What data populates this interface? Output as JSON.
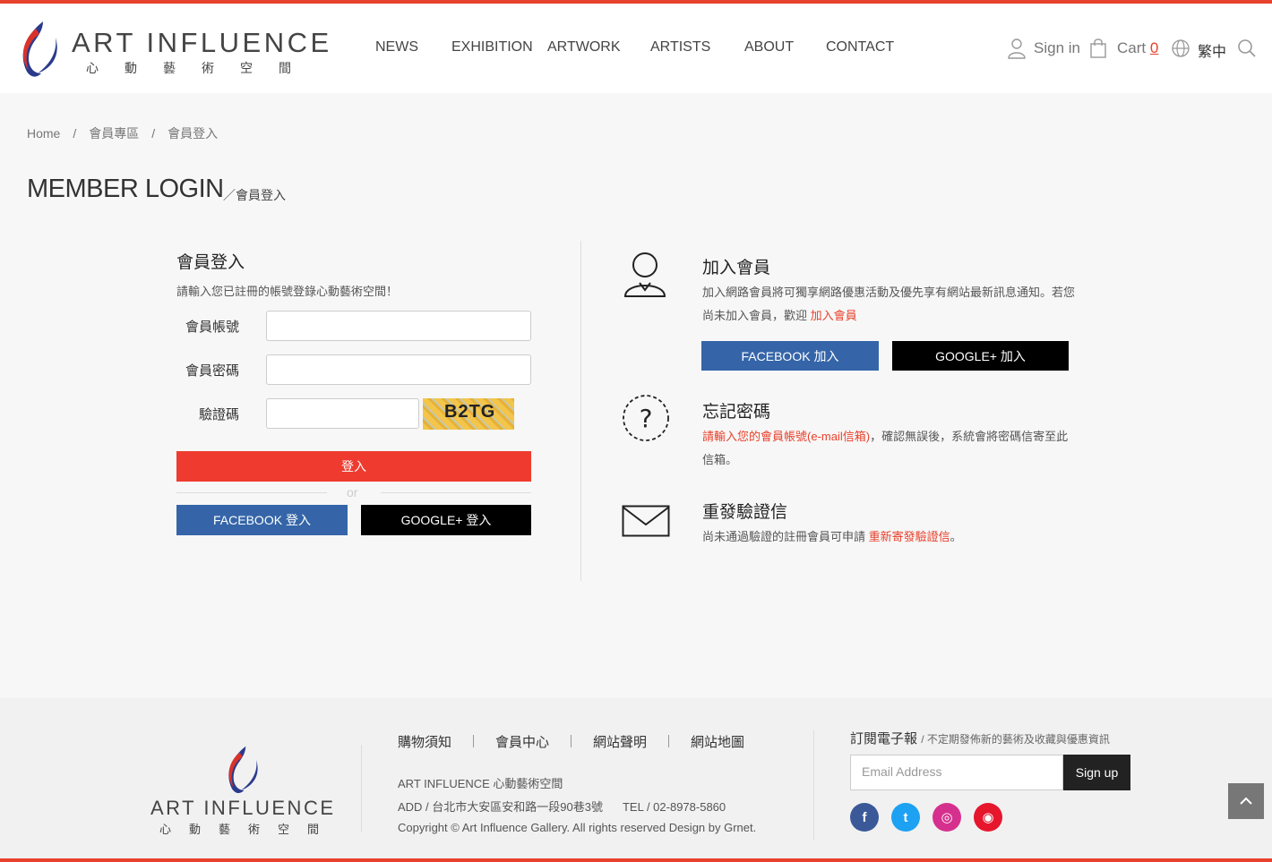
{
  "brand": {
    "name": "ART INFLUENCE",
    "subtitle": "心動藝術空間",
    "accent_color": "#e8412c"
  },
  "nav": {
    "items": [
      "NEWS",
      "EXHIBITION",
      "ARTWORK",
      "ARTISTS",
      "ABOUT",
      "CONTACT"
    ]
  },
  "header_right": {
    "signin_label": "Sign in",
    "cart_label": "Cart",
    "cart_count": "0",
    "language": "繁中",
    "icons": [
      "user-icon",
      "shopping-bag-icon",
      "globe-icon",
      "search-icon"
    ]
  },
  "breadcrumb": {
    "items": [
      "Home",
      "會員專區",
      "會員登入"
    ],
    "separator": "/"
  },
  "page": {
    "title": "MEMBER LOGIN",
    "subtitle": "／會員登入"
  },
  "login": {
    "heading": "會員登入",
    "description": "請輸入您已註冊的帳號登錄心動藝術空間！",
    "account_label": "會員帳號",
    "account_value": "",
    "password_label": "會員密碼",
    "password_value": "",
    "captcha_label": "驗證碼",
    "captcha_value": "",
    "captcha_text": "B2TG",
    "submit_label": "登入",
    "or_text": "or",
    "facebook_label": "FACEBOOK 登入",
    "google_label": "GOOGLE+ 登入"
  },
  "join": {
    "heading": "加入會員",
    "text_part1": "加入網路會員將可獨享網路優惠活動及優先享有網站最新訊息通知。若您尚未加入會員，歡迎",
    "link": "加入會員",
    "facebook_label": "FACEBOOK 加入",
    "google_label": "GOOGLE+ 加入"
  },
  "forgot": {
    "heading": "忘記密碼",
    "text_red": "請輸入您的會員帳號(e-mail信箱)",
    "text_rest": "，確認無誤後，系統會將密碼信寄至此信箱。"
  },
  "resend": {
    "heading": "重發驗證信",
    "text_part1": "尚未通過驗證的註冊會員可申請",
    "link": "重新寄發驗證信",
    "text_part2": "。"
  },
  "footer": {
    "links": [
      "購物須知",
      "會員中心",
      "網站聲明",
      "網站地圖"
    ],
    "company": "ART INFLUENCE 心動藝術空間",
    "address": "ADD / 台北市大安區安和路一段90巷3號",
    "tel": "TEL / 02-8978-5860",
    "copyright": "Copyright © Art Influence Gallery. All rights reserved Design by Grnet.",
    "newsletter_title": "訂閱電子報",
    "newsletter_sub": "/ 不定期發佈新的藝術及收藏與優惠資訊",
    "email_placeholder": "Email Address",
    "signup_label": "Sign up",
    "social": [
      {
        "name": "facebook-icon",
        "glyph": "f",
        "color": "#3b5998"
      },
      {
        "name": "twitter-icon",
        "glyph": "t",
        "color": "#1da1f2"
      },
      {
        "name": "instagram-icon",
        "glyph": "◎",
        "color": "#d6308f"
      },
      {
        "name": "weibo-icon",
        "glyph": "◉",
        "color": "#e6162d"
      }
    ]
  }
}
